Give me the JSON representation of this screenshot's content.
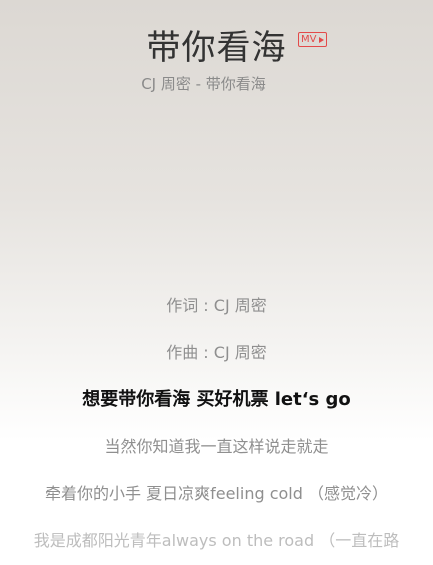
{
  "song": {
    "title": "带你看海",
    "mv_label": "MV",
    "subtitle": "CJ 周密 - 带你看海"
  },
  "lyrics": [
    {
      "text": "作词 : CJ 周密",
      "state": "normal"
    },
    {
      "text": "作曲 : CJ 周密",
      "state": "normal"
    },
    {
      "text": "想要带你看海 买好机票 let‘s go",
      "state": "active"
    },
    {
      "text": "当然你知道我一直这样说走就走",
      "state": "normal"
    },
    {
      "text": "牵着你的小手 夏日凉爽feeling cold （感觉冷）",
      "state": "normal"
    },
    {
      "text": "我是成都阳光青年always on the road （一直在路",
      "state": "dim"
    }
  ],
  "colors": {
    "accent_red": "#e34a4a",
    "active_lyric": "#111111",
    "inactive_lyric": "#8f8f8f"
  }
}
